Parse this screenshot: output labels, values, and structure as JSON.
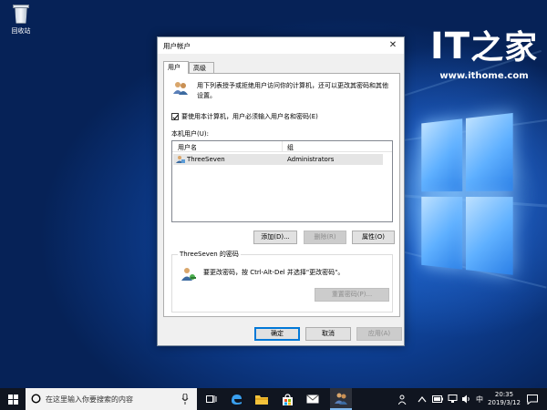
{
  "desktop": {
    "recycle_bin_label": "回收站",
    "brand": {
      "logo_main": "IT",
      "logo_sub": "之家",
      "url": "www.ithome.com"
    }
  },
  "dialog": {
    "title": "用户帐户",
    "close_glyph": "✕",
    "tabs": [
      {
        "label": "用户",
        "active": true
      },
      {
        "label": "高级",
        "active": false
      }
    ],
    "description": "用下列表授予或拒绝用户访问你的计算机，还可以更改其密码和其他设置。",
    "require_login_checkbox": {
      "label": "要使用本计算机，用户必须输入用户名和密码(E)",
      "checked": true
    },
    "users_label": "本机用户(U):",
    "columns": [
      "用户名",
      "组"
    ],
    "users": [
      {
        "name": "ThreeSeven",
        "group": "Administrators",
        "selected": true
      }
    ],
    "buttons": {
      "add": "添加(D)...",
      "remove": "删除(R)",
      "properties": "属性(O)"
    },
    "password_group": {
      "title": "ThreeSeven 的密码",
      "text": "要更改密码，按 Ctrl-Alt-Del 并选择\"更改密码\"。",
      "reset_button": "重置密码(P)..."
    },
    "footer": {
      "ok": "确定",
      "cancel": "取消",
      "apply": "应用(A)"
    }
  },
  "taskbar": {
    "search_placeholder": "在这里输入你要搜索的内容",
    "ime": "中",
    "time": "20:35",
    "date": "2019/3/12"
  },
  "colors": {
    "accent": "#0078d7",
    "taskbar": "#101520"
  }
}
